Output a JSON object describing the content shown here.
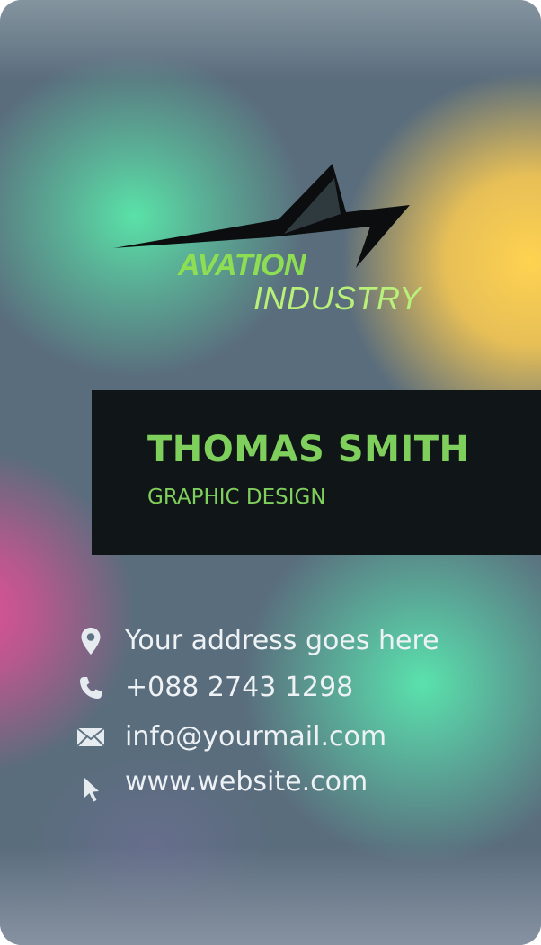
{
  "logo": {
    "line1": "AVATION",
    "line2": "INDUSTRY"
  },
  "person": {
    "name": "THOMAS SMITH",
    "role": "GRAPHIC DESIGN"
  },
  "contacts": [
    {
      "icon": "location-pin-icon",
      "text": "Your address goes here"
    },
    {
      "icon": "phone-icon",
      "text": "+088 2743 1298"
    },
    {
      "icon": "mail-icon",
      "text": "info@yourmail.com"
    },
    {
      "icon": "cursor-icon",
      "text": "www.website.com"
    }
  ],
  "colors": {
    "accent_green": "#7fcf5c",
    "name_box": "#101517",
    "contact_text": "#eef2f5"
  }
}
